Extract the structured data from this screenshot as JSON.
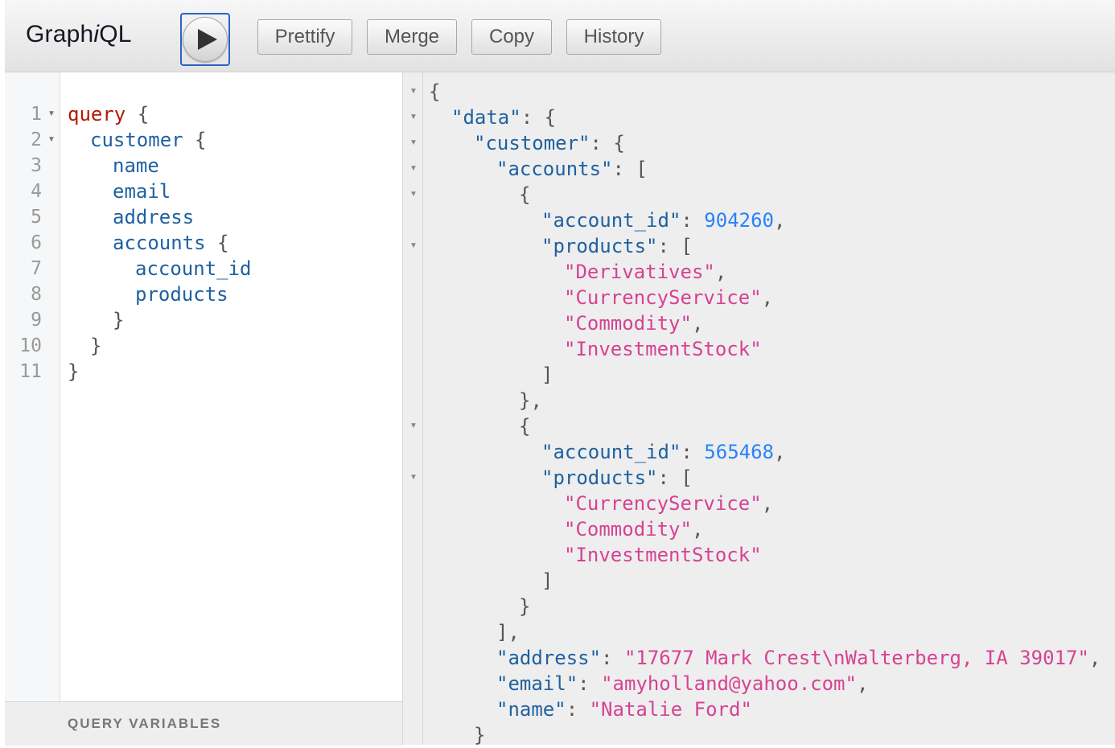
{
  "app": {
    "title_prefix": "Graph",
    "title_italic": "i",
    "title_suffix": "QL"
  },
  "toolbar": {
    "execute_icon": "play-icon",
    "buttons": [
      "Prettify",
      "Merge",
      "Copy",
      "History"
    ]
  },
  "editor": {
    "lines": [
      {
        "num": "1",
        "fold": true,
        "tokens": [
          [
            "kw",
            "query"
          ],
          [
            "pn",
            " {"
          ]
        ],
        "indent": 0
      },
      {
        "num": "2",
        "fold": true,
        "tokens": [
          [
            "fld",
            "customer"
          ],
          [
            "pn",
            " {"
          ]
        ],
        "indent": 1
      },
      {
        "num": "3",
        "fold": false,
        "tokens": [
          [
            "fld",
            "name"
          ]
        ],
        "indent": 2
      },
      {
        "num": "4",
        "fold": false,
        "tokens": [
          [
            "fld",
            "email"
          ]
        ],
        "indent": 2
      },
      {
        "num": "5",
        "fold": false,
        "tokens": [
          [
            "fld",
            "address"
          ]
        ],
        "indent": 2
      },
      {
        "num": "6",
        "fold": false,
        "tokens": [
          [
            "fld",
            "accounts"
          ],
          [
            "pn",
            " {"
          ]
        ],
        "indent": 2
      },
      {
        "num": "7",
        "fold": false,
        "tokens": [
          [
            "fld",
            "account_id"
          ]
        ],
        "indent": 3
      },
      {
        "num": "8",
        "fold": false,
        "tokens": [
          [
            "fld",
            "products"
          ]
        ],
        "indent": 3
      },
      {
        "num": "9",
        "fold": false,
        "tokens": [
          [
            "pn",
            "}"
          ]
        ],
        "indent": 2
      },
      {
        "num": "10",
        "fold": false,
        "tokens": [
          [
            "pn",
            "}"
          ]
        ],
        "indent": 1
      },
      {
        "num": "11",
        "fold": false,
        "tokens": [
          [
            "pn",
            "}"
          ]
        ],
        "indent": 0
      }
    ],
    "query_variables_label": "QUERY VARIABLES"
  },
  "result": {
    "lines": [
      {
        "fold": true,
        "indent": 0,
        "tokens": [
          [
            "pn",
            "{"
          ]
        ]
      },
      {
        "fold": true,
        "indent": 1,
        "tokens": [
          [
            "key",
            "\"data\""
          ],
          [
            "pn",
            ": {"
          ]
        ]
      },
      {
        "fold": true,
        "indent": 2,
        "tokens": [
          [
            "key",
            "\"customer\""
          ],
          [
            "pn",
            ": {"
          ]
        ]
      },
      {
        "fold": true,
        "indent": 3,
        "tokens": [
          [
            "key",
            "\"accounts\""
          ],
          [
            "pn",
            ": ["
          ]
        ]
      },
      {
        "fold": true,
        "indent": 4,
        "tokens": [
          [
            "pn",
            "{"
          ]
        ]
      },
      {
        "fold": false,
        "indent": 5,
        "tokens": [
          [
            "key",
            "\"account_id\""
          ],
          [
            "pn",
            ": "
          ],
          [
            "num",
            "904260"
          ],
          [
            "pn",
            ","
          ]
        ]
      },
      {
        "fold": true,
        "indent": 5,
        "tokens": [
          [
            "key",
            "\"products\""
          ],
          [
            "pn",
            ": ["
          ]
        ]
      },
      {
        "fold": false,
        "indent": 6,
        "tokens": [
          [
            "str",
            "\"Derivatives\""
          ],
          [
            "pn",
            ","
          ]
        ]
      },
      {
        "fold": false,
        "indent": 6,
        "tokens": [
          [
            "str",
            "\"CurrencyService\""
          ],
          [
            "pn",
            ","
          ]
        ]
      },
      {
        "fold": false,
        "indent": 6,
        "tokens": [
          [
            "str",
            "\"Commodity\""
          ],
          [
            "pn",
            ","
          ]
        ]
      },
      {
        "fold": false,
        "indent": 6,
        "tokens": [
          [
            "str",
            "\"InvestmentStock\""
          ]
        ]
      },
      {
        "fold": false,
        "indent": 5,
        "tokens": [
          [
            "pn",
            "]"
          ]
        ]
      },
      {
        "fold": false,
        "indent": 4,
        "tokens": [
          [
            "pn",
            "},"
          ]
        ]
      },
      {
        "fold": true,
        "indent": 4,
        "tokens": [
          [
            "pn",
            "{"
          ]
        ]
      },
      {
        "fold": false,
        "indent": 5,
        "tokens": [
          [
            "key",
            "\"account_id\""
          ],
          [
            "pn",
            ": "
          ],
          [
            "num",
            "565468"
          ],
          [
            "pn",
            ","
          ]
        ]
      },
      {
        "fold": true,
        "indent": 5,
        "tokens": [
          [
            "key",
            "\"products\""
          ],
          [
            "pn",
            ": ["
          ]
        ]
      },
      {
        "fold": false,
        "indent": 6,
        "tokens": [
          [
            "str",
            "\"CurrencyService\""
          ],
          [
            "pn",
            ","
          ]
        ]
      },
      {
        "fold": false,
        "indent": 6,
        "tokens": [
          [
            "str",
            "\"Commodity\""
          ],
          [
            "pn",
            ","
          ]
        ]
      },
      {
        "fold": false,
        "indent": 6,
        "tokens": [
          [
            "str",
            "\"InvestmentStock\""
          ]
        ]
      },
      {
        "fold": false,
        "indent": 5,
        "tokens": [
          [
            "pn",
            "]"
          ]
        ]
      },
      {
        "fold": false,
        "indent": 4,
        "tokens": [
          [
            "pn",
            "}"
          ]
        ]
      },
      {
        "fold": false,
        "indent": 3,
        "tokens": [
          [
            "pn",
            "],"
          ]
        ]
      },
      {
        "fold": false,
        "indent": 3,
        "tokens": [
          [
            "key",
            "\"address\""
          ],
          [
            "pn",
            ": "
          ],
          [
            "str",
            "\"17677 Mark Crest\\nWalterberg, IA 39017\""
          ],
          [
            "pn",
            ","
          ]
        ]
      },
      {
        "fold": false,
        "indent": 3,
        "tokens": [
          [
            "key",
            "\"email\""
          ],
          [
            "pn",
            ": "
          ],
          [
            "str",
            "\"amyholland@yahoo.com\""
          ],
          [
            "pn",
            ","
          ]
        ]
      },
      {
        "fold": false,
        "indent": 3,
        "tokens": [
          [
            "key",
            "\"name\""
          ],
          [
            "pn",
            ": "
          ],
          [
            "str",
            "\"Natalie Ford\""
          ]
        ]
      },
      {
        "fold": false,
        "indent": 2,
        "tokens": [
          [
            "pn",
            "}"
          ]
        ]
      }
    ]
  },
  "colors": {
    "accent": "#2a64c6",
    "keyword": "#b11a04",
    "field": "#1f61a0",
    "string": "#d64292",
    "number": "#2882f9"
  }
}
